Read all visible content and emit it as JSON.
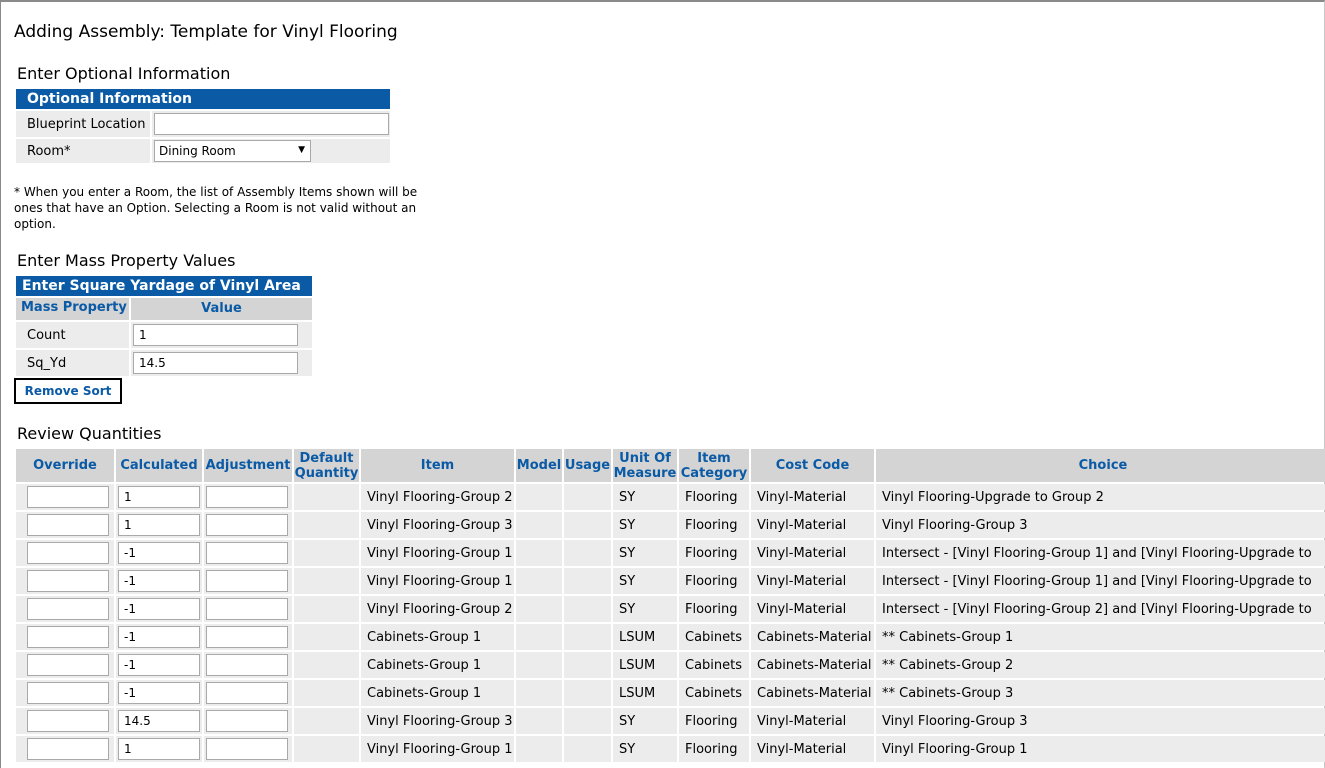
{
  "page_title": "Adding Assembly: Template for Vinyl Flooring",
  "optional": {
    "section_title": "Enter Optional Information",
    "header": "Optional Information",
    "blueprint_label": "Blueprint Location",
    "blueprint_value": "",
    "room_label": "Room*",
    "room_value": "Dining Room"
  },
  "note": "* When you enter a Room, the list of Assembly Items shown will be ones that have an Option. Selecting a Room is not valid without an option.",
  "mass": {
    "section_title": "Enter Mass Property Values",
    "header": "Enter Square Yardage of Vinyl Area",
    "col_property": "Mass Property",
    "col_value": "Value",
    "rows": [
      {
        "label": "Count",
        "value": "1"
      },
      {
        "label": "Sq_Yd",
        "value": "14.5"
      }
    ]
  },
  "remove_sort_label": "Remove Sort",
  "review": {
    "section_title": "Review Quantities",
    "headers": {
      "override": "Override",
      "calculated": "Calculated",
      "adjustment": "Adjustment",
      "default_quantity_1": "Default",
      "default_quantity_2": "Quantity",
      "item": "Item",
      "model": "Model",
      "usage": "Usage",
      "uom_1": "Unit Of",
      "uom_2": "Measure",
      "category_1": "Item",
      "category_2": "Category",
      "cost_code": "Cost Code",
      "choice": "Choice"
    },
    "rows": [
      {
        "override": "",
        "calculated": "1",
        "adjustment": "",
        "item": "Vinyl Flooring-Group 2",
        "uom": "SY",
        "category": "Flooring",
        "cost_code": "Vinyl-Material",
        "choice": "Vinyl Flooring-Upgrade to Group 2"
      },
      {
        "override": "",
        "calculated": "1",
        "adjustment": "",
        "item": "Vinyl Flooring-Group 3",
        "uom": "SY",
        "category": "Flooring",
        "cost_code": "Vinyl-Material",
        "choice": "Vinyl Flooring-Group 3"
      },
      {
        "override": "",
        "calculated": "-1",
        "adjustment": "",
        "item": "Vinyl Flooring-Group 1",
        "uom": "SY",
        "category": "Flooring",
        "cost_code": "Vinyl-Material",
        "choice": "Intersect - [Vinyl Flooring-Group 1] and [Vinyl Flooring-Upgrade to"
      },
      {
        "override": "",
        "calculated": "-1",
        "adjustment": "",
        "item": "Vinyl Flooring-Group 1",
        "uom": "SY",
        "category": "Flooring",
        "cost_code": "Vinyl-Material",
        "choice": "Intersect - [Vinyl Flooring-Group 1] and [Vinyl Flooring-Upgrade to"
      },
      {
        "override": "",
        "calculated": "-1",
        "adjustment": "",
        "item": "Vinyl Flooring-Group 2",
        "uom": "SY",
        "category": "Flooring",
        "cost_code": "Vinyl-Material",
        "choice": "Intersect - [Vinyl Flooring-Group 2] and [Vinyl Flooring-Upgrade to"
      },
      {
        "override": "",
        "calculated": "-1",
        "adjustment": "",
        "item": "Cabinets-Group 1",
        "uom": "LSUM",
        "category": "Cabinets",
        "cost_code": "Cabinets-Material",
        "choice": "** Cabinets-Group 1"
      },
      {
        "override": "",
        "calculated": "-1",
        "adjustment": "",
        "item": "Cabinets-Group 1",
        "uom": "LSUM",
        "category": "Cabinets",
        "cost_code": "Cabinets-Material",
        "choice": "** Cabinets-Group 2"
      },
      {
        "override": "",
        "calculated": "-1",
        "adjustment": "",
        "item": "Cabinets-Group 1",
        "uom": "LSUM",
        "category": "Cabinets",
        "cost_code": "Cabinets-Material",
        "choice": "** Cabinets-Group 3"
      },
      {
        "override": "",
        "calculated": "14.5",
        "adjustment": "",
        "item": "Vinyl Flooring-Group 3",
        "uom": "SY",
        "category": "Flooring",
        "cost_code": "Vinyl-Material",
        "choice": "Vinyl Flooring-Group 3"
      },
      {
        "override": "",
        "calculated": "1",
        "adjustment": "",
        "item": "Vinyl Flooring-Group 1",
        "uom": "SY",
        "category": "Flooring",
        "cost_code": "Vinyl-Material",
        "choice": "Vinyl Flooring-Group 1"
      }
    ]
  }
}
